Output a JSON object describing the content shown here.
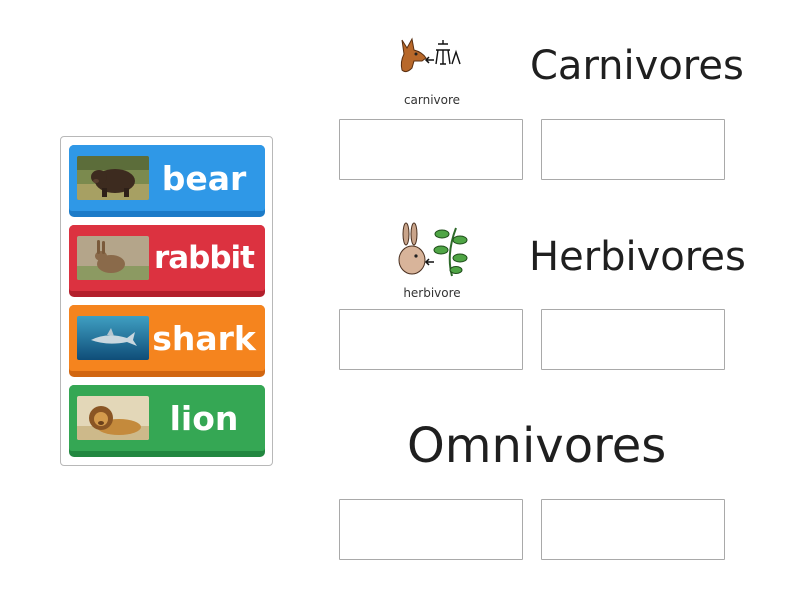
{
  "tray": {
    "cards": [
      {
        "id": "bear",
        "label": "bear",
        "image": "bear-photo",
        "color": "#2f98e7"
      },
      {
        "id": "rabbit",
        "label": "rabbit",
        "image": "rabbit-photo",
        "color": "#dc3240"
      },
      {
        "id": "shark",
        "label": "shark",
        "image": "shark-photo",
        "color": "#f5841e"
      },
      {
        "id": "lion",
        "label": "lion",
        "image": "lion-photo",
        "color": "#35a754"
      }
    ]
  },
  "groups": [
    {
      "id": "carnivores",
      "title": "Carnivores",
      "symbol": "carnivore-symbol-icon",
      "symbol_caption": "carnivore",
      "slots": 2
    },
    {
      "id": "herbivores",
      "title": "Herbivores",
      "symbol": "herbivore-symbol-icon",
      "symbol_caption": "herbivore",
      "slots": 2
    },
    {
      "id": "omnivores",
      "title": "Omnivores",
      "slots": 2
    }
  ]
}
